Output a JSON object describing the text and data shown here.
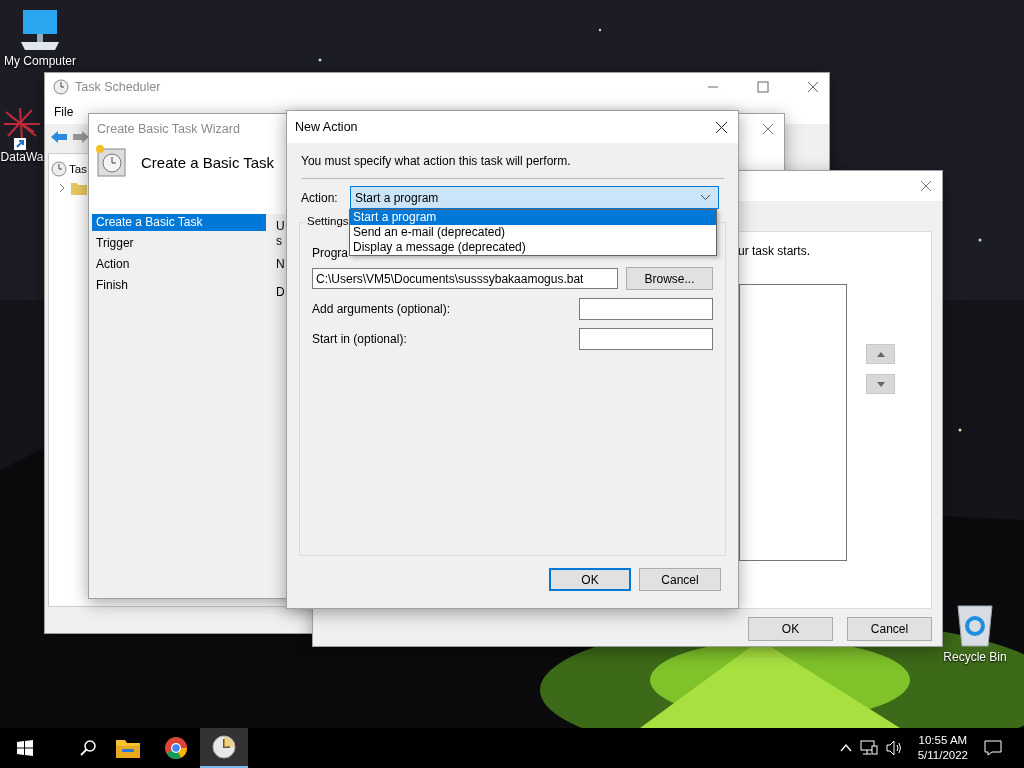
{
  "desktop_icons": [
    {
      "label": "My Computer",
      "kind": "computer"
    },
    {
      "label": "DataWa",
      "kind": "app"
    },
    {
      "label": "Recycle Bin",
      "kind": "recycle"
    }
  ],
  "task_scheduler": {
    "title": "Task Scheduler",
    "menu": [
      "File"
    ],
    "tree_root": "Tas"
  },
  "wizard": {
    "title": "Create Basic Task Wizard",
    "heading": "Create a Basic Task",
    "steps": [
      {
        "label": "Create a Basic Task",
        "selected": true
      },
      {
        "label": "Trigger",
        "selected": false
      },
      {
        "label": "Action",
        "selected": false
      },
      {
        "label": "Finish",
        "selected": false
      }
    ],
    "cut_texts": [
      "U",
      "s",
      "N",
      "D"
    ]
  },
  "create_action": {
    "instruction": "ur task starts.",
    "buttons": [
      {
        "label": "OK",
        "default": false
      },
      {
        "label": "Cancel",
        "default": false
      }
    ]
  },
  "new_action": {
    "title": "New Action",
    "instruction": "You must specify what action this task will perform.",
    "action_label": "Action:",
    "action_value": "Start a program",
    "action_options": [
      {
        "label": "Start a program",
        "selected": true
      },
      {
        "label": "Send an e-mail (deprecated)",
        "selected": false
      },
      {
        "label": "Display a message (deprecated)",
        "selected": false
      }
    ],
    "settings_label": "Settings",
    "program_label": "Progra",
    "program_value": "C:\\Users\\VM5\\Documents\\susssybakaamogus.bat",
    "browse": "Browse...",
    "fields": [
      {
        "label": "Add arguments (optional):"
      },
      {
        "label": "Start in (optional):"
      }
    ],
    "buttons": [
      {
        "label": "OK",
        "default": true
      },
      {
        "label": "Cancel",
        "default": false
      }
    ]
  },
  "taskbar": {
    "apps": [
      {
        "kind": "folder",
        "active": false
      },
      {
        "kind": "browser",
        "active": false
      },
      {
        "kind": "clock",
        "active": true
      }
    ],
    "time": "10:55 AM",
    "date": "5/11/2022"
  }
}
